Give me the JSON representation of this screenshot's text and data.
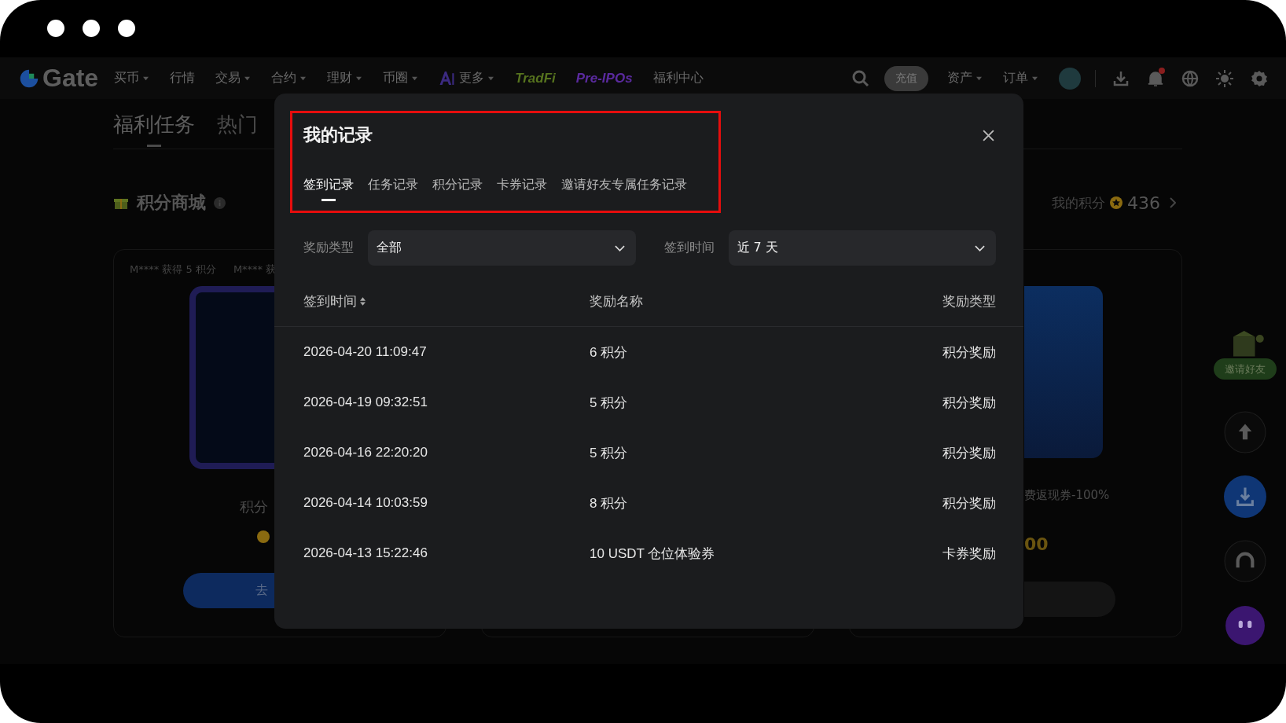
{
  "nav": {
    "logo": "Gate",
    "items": [
      {
        "label": "买币",
        "kind": "menu",
        "dropdown": true
      },
      {
        "label": "行情",
        "kind": "menu",
        "dropdown": false
      },
      {
        "label": "交易",
        "kind": "menu",
        "dropdown": true
      },
      {
        "label": "合约",
        "kind": "menu",
        "dropdown": true
      },
      {
        "label": "理财",
        "kind": "menu",
        "dropdown": true
      },
      {
        "label": "币圈",
        "kind": "menu",
        "dropdown": true
      },
      {
        "label": "更多",
        "kind": "ai",
        "dropdown": true
      },
      {
        "label": "TradFi",
        "kind": "brand",
        "dropdown": false,
        "color": "#56731e"
      },
      {
        "label": "Pre-IPOs",
        "kind": "brand",
        "dropdown": false,
        "color": "#5a2a9e"
      },
      {
        "label": "福利中心",
        "kind": "menu",
        "dropdown": false
      }
    ],
    "deposit": "充值",
    "menus": [
      {
        "label": "资产",
        "dropdown": true
      },
      {
        "label": "订单",
        "dropdown": true
      }
    ],
    "notification": true
  },
  "page": {
    "tabs": [
      {
        "label": "福利任务",
        "selected": true
      },
      {
        "label": "热门",
        "selected": false
      }
    ],
    "section_title": "积分商城",
    "my_points": {
      "label": "我的积分",
      "value": "436"
    },
    "left_card": {
      "ticker": [
        "M**** 获得 5 积分",
        "M**** 获"
      ],
      "title": "积分",
      "button": "去"
    },
    "right_card": {
      "title": "费返现券-100%",
      "price": "00"
    },
    "invite": "邀请好友"
  },
  "modal": {
    "title": "我的记录",
    "tabs": [
      {
        "label": "签到记录",
        "selected": true
      },
      {
        "label": "任务记录",
        "selected": false
      },
      {
        "label": "积分记录",
        "selected": false
      },
      {
        "label": "卡券记录",
        "selected": false
      },
      {
        "label": "邀请好友专属任务记录",
        "selected": false
      }
    ],
    "filters": [
      {
        "label": "奖励类型",
        "value": "全部"
      },
      {
        "label": "签到时间",
        "value": "近 7 天"
      }
    ],
    "columns": [
      {
        "label": "签到时间",
        "sortable": true
      },
      {
        "label": "奖励名称",
        "sortable": false
      },
      {
        "label": "奖励类型",
        "sortable": false
      }
    ],
    "rows": [
      {
        "time": "2026-04-20 11:09:47",
        "name": "6 积分",
        "type": "积分奖励"
      },
      {
        "time": "2026-04-19 09:32:51",
        "name": "5 积分",
        "type": "积分奖励"
      },
      {
        "time": "2026-04-16 22:20:20",
        "name": "5 积分",
        "type": "积分奖励"
      },
      {
        "time": "2026-04-14 10:03:59",
        "name": "8 积分",
        "type": "积分奖励"
      },
      {
        "time": "2026-04-13 15:22:46",
        "name": "10 USDT 仓位体验券",
        "type": "卡券奖励"
      }
    ]
  }
}
